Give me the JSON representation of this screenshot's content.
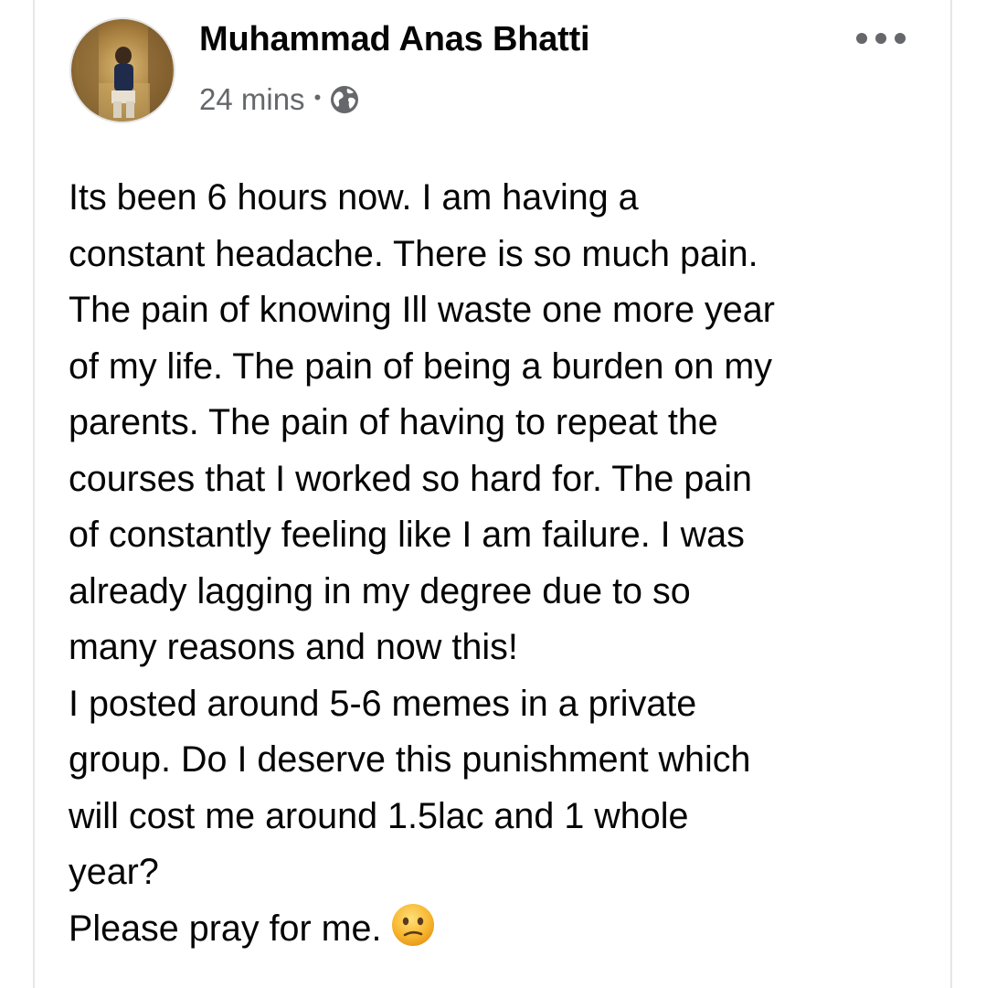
{
  "post": {
    "author": "Muhammad Anas Bhatti",
    "timestamp": "24 mins",
    "separator": "•",
    "audience_icon": "globe-icon",
    "more_icon": "more-options-icon",
    "lines": [
      "Its been 6 hours now. I am having a",
      "constant headache. There is so much pain.",
      "The pain of knowing Ill waste one more year",
      "of my life. The pain of being a burden on my",
      "parents. The pain of having to repeat the",
      "courses that I worked so hard for. The pain",
      "of constantly feeling like I am failure. I was",
      "already lagging in my degree due to so",
      "many reasons and now this!",
      "I posted around 5-6 memes in a private",
      "group. Do I deserve this punishment which",
      "will cost me around 1.5lac and 1 whole",
      "year?",
      "Please pray for me."
    ],
    "closing_emoji": "confused-face-emoji"
  },
  "colors": {
    "text_primary": "#050505",
    "text_secondary": "#65676b",
    "card_border": "#e6e6e6",
    "emoji_fill": "#f7b52e"
  }
}
